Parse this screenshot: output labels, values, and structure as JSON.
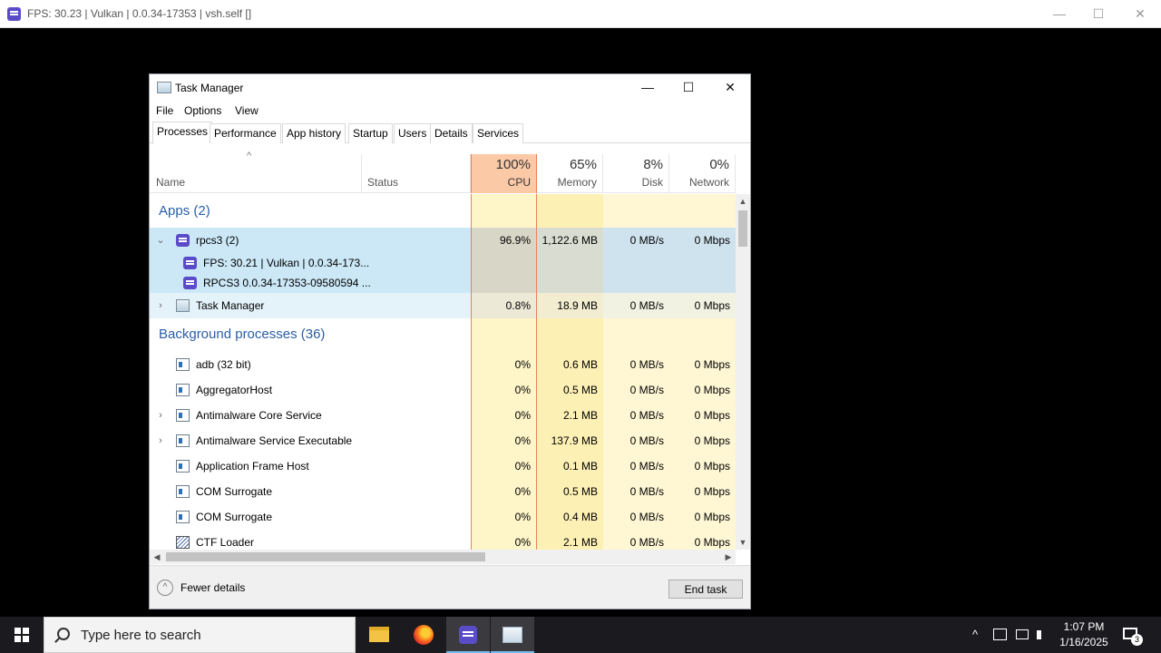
{
  "outer_window": {
    "title": "FPS: 30.23 | Vulkan | 0.0.34-17353 | vsh.self []",
    "minimize": "—",
    "maximize": "☐",
    "close": "✕"
  },
  "task_manager": {
    "title": "Task Manager",
    "minimize": "—",
    "maximize": "☐",
    "close": "✕",
    "menu": [
      "File",
      "Options",
      "View"
    ],
    "tabs": [
      "Processes",
      "Performance",
      "App history",
      "Startup",
      "Users",
      "Details",
      "Services"
    ],
    "active_tab": "Processes",
    "columns": {
      "sort_arrow": "^",
      "name": "Name",
      "status": "Status",
      "cpu": {
        "pct": "100%",
        "label": "CPU"
      },
      "memory": {
        "pct": "65%",
        "label": "Memory"
      },
      "disk": {
        "pct": "8%",
        "label": "Disk"
      },
      "network": {
        "pct": "0%",
        "label": "Network"
      }
    },
    "groups": {
      "apps": "Apps (2)",
      "background": "Background processes (36)"
    },
    "rows": {
      "rpcs3": {
        "expander": "⌄",
        "name": "rpcs3 (2)",
        "cpu": "96.9%",
        "memory": "1,122.6 MB",
        "disk": "0 MB/s",
        "network": "0 Mbps"
      },
      "rpcs3_child1": {
        "name": "FPS: 30.21 | Vulkan | 0.0.34-173..."
      },
      "rpcs3_child2": {
        "name": "RPCS3 0.0.34-17353-09580594 ..."
      },
      "taskmgr": {
        "expander": "›",
        "name": "Task Manager",
        "cpu": "0.8%",
        "memory": "18.9 MB",
        "disk": "0 MB/s",
        "network": "0 Mbps"
      }
    },
    "background_processes": [
      {
        "expander": "",
        "icon": "svc",
        "name": "adb (32 bit)",
        "cpu": "0%",
        "memory": "0.6 MB",
        "disk": "0 MB/s",
        "network": "0 Mbps"
      },
      {
        "expander": "",
        "icon": "svc",
        "name": "AggregatorHost",
        "cpu": "0%",
        "memory": "0.5 MB",
        "disk": "0 MB/s",
        "network": "0 Mbps"
      },
      {
        "expander": "›",
        "icon": "svc",
        "name": "Antimalware Core Service",
        "cpu": "0%",
        "memory": "2.1 MB",
        "disk": "0 MB/s",
        "network": "0 Mbps"
      },
      {
        "expander": "›",
        "icon": "svc",
        "name": "Antimalware Service Executable",
        "cpu": "0%",
        "memory": "137.9 MB",
        "disk": "0 MB/s",
        "network": "0 Mbps"
      },
      {
        "expander": "",
        "icon": "svc",
        "name": "Application Frame Host",
        "cpu": "0%",
        "memory": "0.1 MB",
        "disk": "0 MB/s",
        "network": "0 Mbps"
      },
      {
        "expander": "",
        "icon": "svc",
        "name": "COM Surrogate",
        "cpu": "0%",
        "memory": "0.5 MB",
        "disk": "0 MB/s",
        "network": "0 Mbps"
      },
      {
        "expander": "",
        "icon": "svc",
        "name": "COM Surrogate",
        "cpu": "0%",
        "memory": "0.4 MB",
        "disk": "0 MB/s",
        "network": "0 Mbps"
      },
      {
        "expander": "",
        "icon": "ctf",
        "name": "CTF Loader",
        "cpu": "0%",
        "memory": "2.1 MB",
        "disk": "0 MB/s",
        "network": "0 Mbps"
      }
    ],
    "scroll": {
      "up": "▲",
      "down": "▼",
      "left": "◀",
      "right": "▶"
    },
    "footer": {
      "fewer_icon": "^",
      "fewer_details": "Fewer details",
      "end_task": "End task"
    }
  },
  "taskbar": {
    "search_placeholder": "Type here to search",
    "clock_time": "1:07 PM",
    "clock_date": "1/16/2025",
    "notification_count": "3",
    "tray_chevron": "^"
  }
}
